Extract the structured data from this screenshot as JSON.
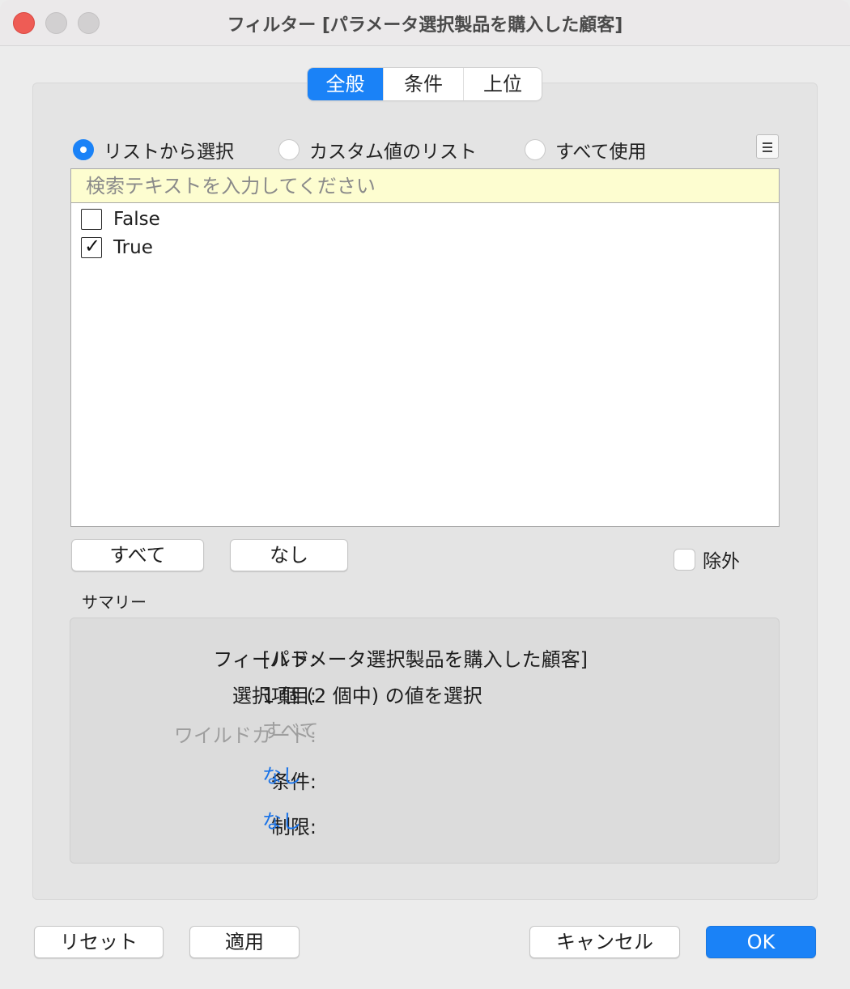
{
  "window": {
    "title": "フィルター [パラメータ選択製品を購入した顧客]"
  },
  "tabs": [
    {
      "label": "全般",
      "active": true
    },
    {
      "label": "条件",
      "active": false
    },
    {
      "label": "上位",
      "active": false
    }
  ],
  "mode": {
    "options": [
      {
        "label": "リストから選択",
        "selected": true
      },
      {
        "label": "カスタム値のリスト",
        "selected": false
      },
      {
        "label": "すべて使用",
        "selected": false
      }
    ]
  },
  "list": {
    "search_placeholder": "検索テキストを入力してください",
    "items": [
      {
        "label": "False",
        "checked": false
      },
      {
        "label": "True",
        "checked": true
      }
    ]
  },
  "list_actions": {
    "all_label": "すべて",
    "none_label": "なし",
    "exclude_label": "除外",
    "exclude_checked": false
  },
  "summary": {
    "heading": "サマリー",
    "rows": [
      {
        "label": "フィールド:",
        "value": "[パラメータ選択製品を購入した顧客]"
      },
      {
        "label": "選択項目:",
        "value": "1 個 (2 個中) の値を選択"
      },
      {
        "label": "ワイルドカード:",
        "value": "すべて"
      },
      {
        "label": "条件:",
        "value": "なし"
      },
      {
        "label": "制限:",
        "value": "なし"
      }
    ]
  },
  "footer": {
    "reset_label": "リセット",
    "apply_label": "適用",
    "cancel_label": "キャンセル",
    "ok_label": "OK"
  },
  "colors": {
    "accent": "#1a82f7",
    "link": "#1a73e8",
    "search_bg": "#fdfdd0",
    "close": "#ee5c55"
  },
  "icons": [
    "close-button-icon",
    "minimize-button-icon",
    "zoom-button-icon",
    "list-menu-icon",
    "checkmark-icon"
  ]
}
